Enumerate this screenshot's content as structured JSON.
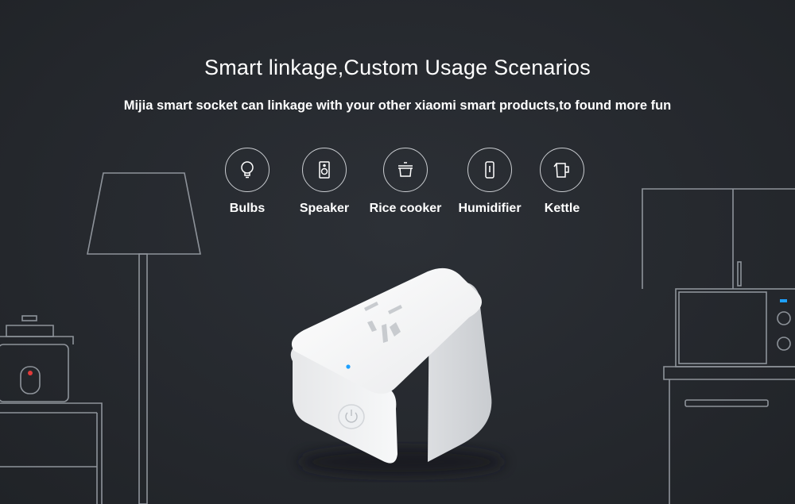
{
  "header": {
    "title": "Smart linkage,Custom Usage Scenarios",
    "subtitle": "Mijia smart socket can linkage with your other xiaomi smart products,to found more fun"
  },
  "devices": [
    {
      "label": "Bulbs",
      "icon": "bulb-icon"
    },
    {
      "label": "Speaker",
      "icon": "speaker-icon"
    },
    {
      "label": "Rice cooker",
      "icon": "rice-cooker-icon"
    },
    {
      "label": "Humidifier",
      "icon": "humidifier-icon"
    },
    {
      "label": "Kettle",
      "icon": "kettle-icon"
    }
  ],
  "colors": {
    "background": "#262a2f",
    "line_art": "#8e939a",
    "indicator_blue": "#1ea0ff",
    "indicator_red": "#e23a3a",
    "socket_white": "#f4f5f6"
  }
}
